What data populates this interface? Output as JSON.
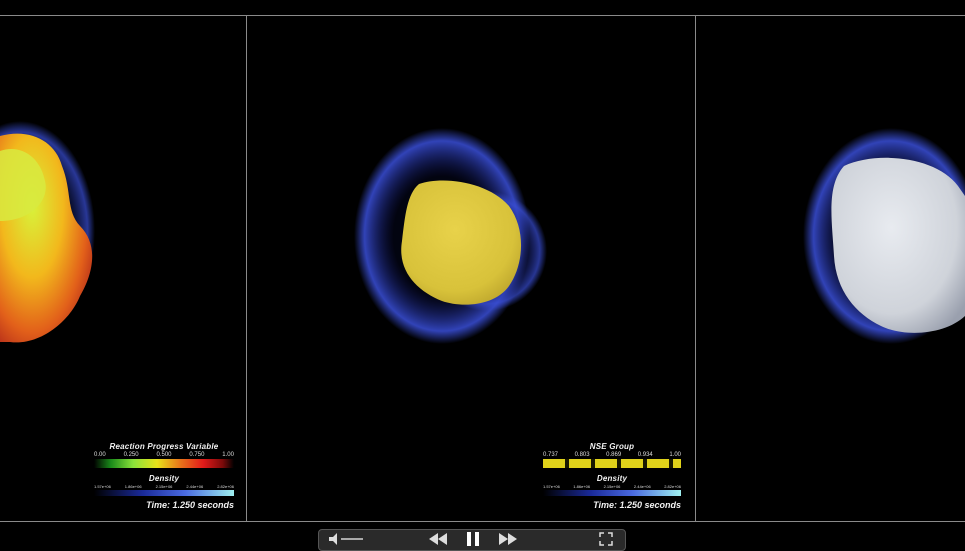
{
  "panels": [
    {
      "legend_title": "Reaction Progress Variable",
      "ticks": [
        "0.00",
        "0.250",
        "0.500",
        "0.750",
        "1.00"
      ],
      "density_title": "Density",
      "density_ticks": [
        "1.57e+06",
        "1.86e+06",
        "2.15e+06",
        "2.44e+06",
        "2.82e+06"
      ],
      "time": "Time: 1.250 seconds"
    },
    {
      "legend_title": "NSE Group",
      "ticks": [
        "0.737",
        "0.803",
        "0.869",
        "0.934",
        "1.00"
      ],
      "density_title": "Density",
      "density_ticks": [
        "1.57e+06",
        "1.86e+06",
        "2.15e+06",
        "2.44e+06",
        "2.82e+06"
      ],
      "time": "Time: 1.250 seconds"
    }
  ],
  "controls": {
    "volume_icon": "volume-icon",
    "rewind_icon": "rewind-icon",
    "pause_icon": "pause-icon",
    "forward_icon": "fast-forward-icon",
    "fullscreen_icon": "fullscreen-icon"
  },
  "colors": {
    "orange_blob": "#e8741a",
    "yellow_blob": "#d8c23a",
    "white_blob": "#cfd3da",
    "blue_shell": "#3a4fd8"
  }
}
